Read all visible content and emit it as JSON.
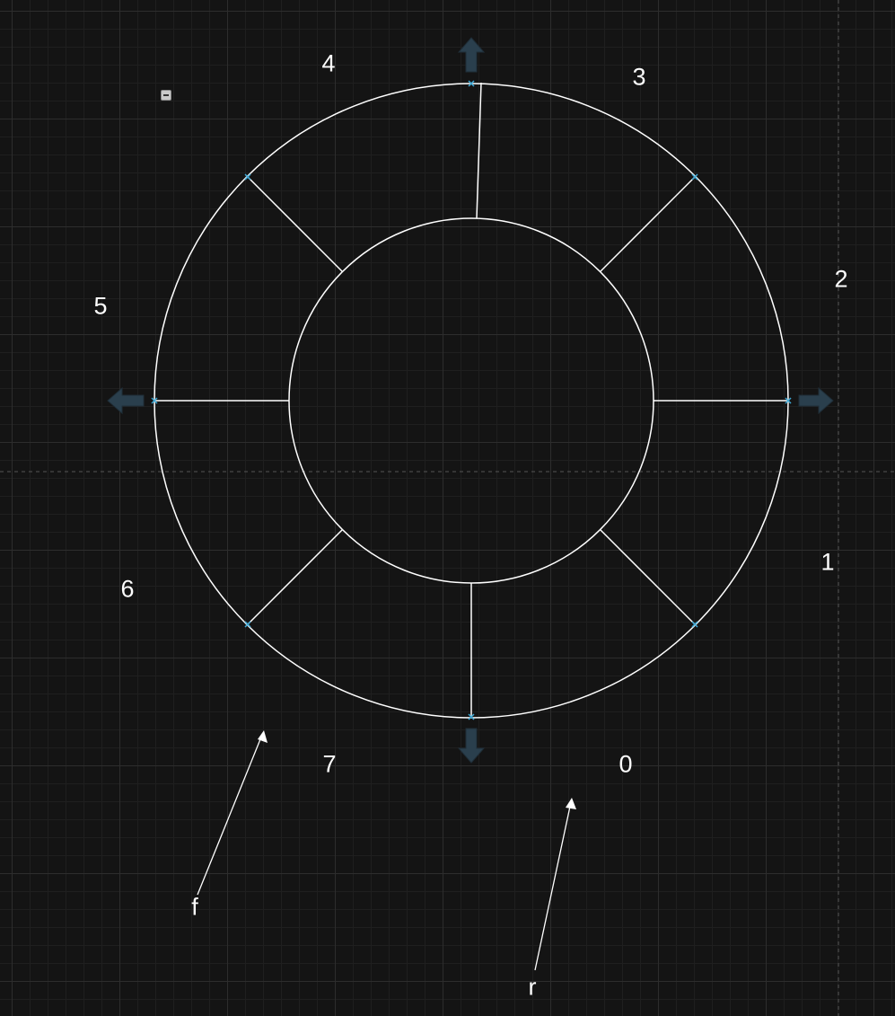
{
  "segment_labels": {
    "s0": "0",
    "s1": "1",
    "s2": "2",
    "s3": "3",
    "s4": "4",
    "s5": "5",
    "s6": "6",
    "s7": "7"
  },
  "arrow_labels": {
    "f": "f",
    "r": "r"
  },
  "colors": {
    "background": "#141414",
    "stroke": "#ffffff",
    "handle": "#3fa9d6",
    "direction_arrow": "#2a3f4d"
  },
  "icons": {
    "collapse": "collapse-minus-icon",
    "direction_arrows": [
      "arrow-up-icon",
      "arrow-right-icon",
      "arrow-down-icon",
      "arrow-left-icon"
    ]
  }
}
